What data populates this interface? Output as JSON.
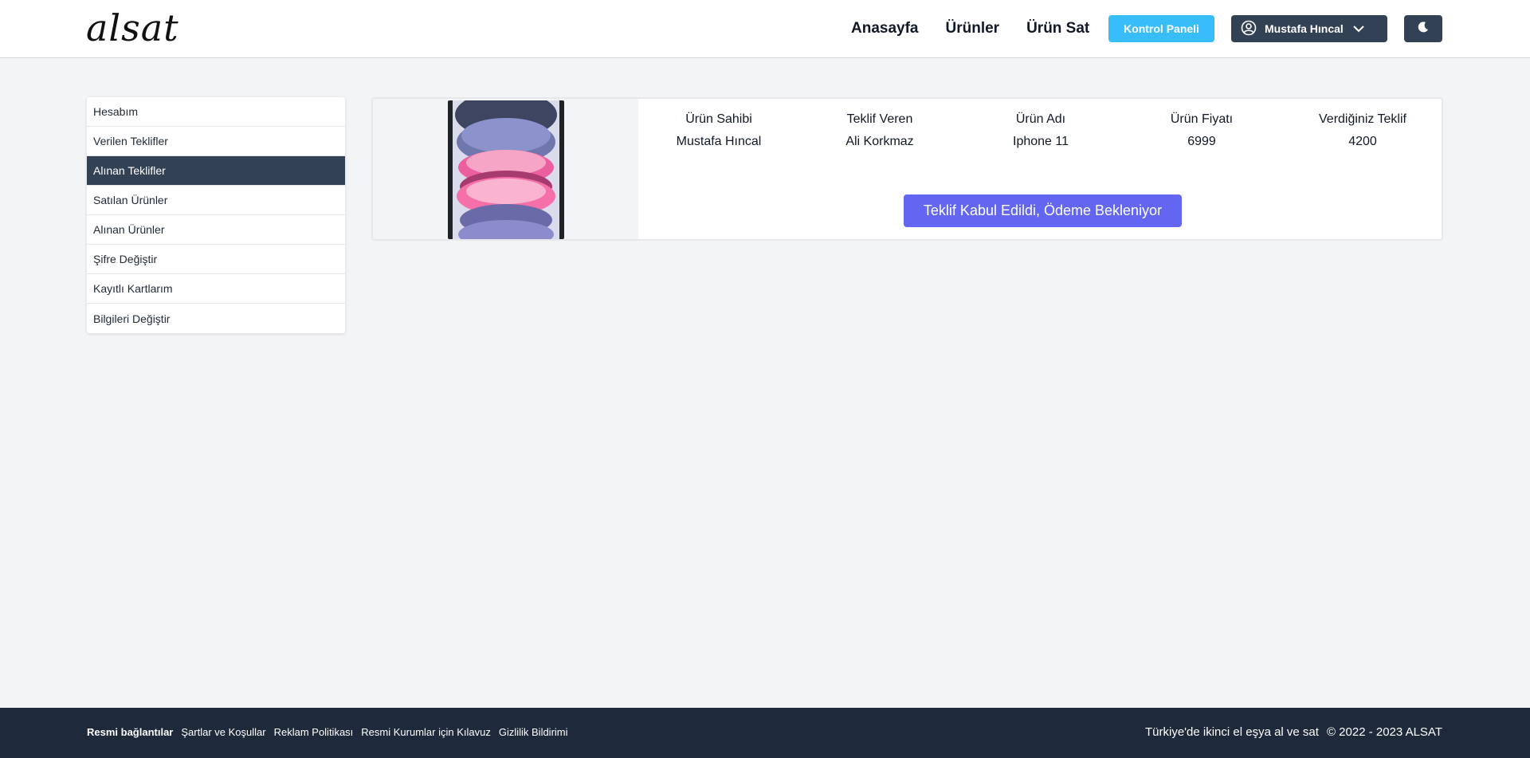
{
  "header": {
    "logo": "alsat",
    "nav": [
      "Anasayfa",
      "Ürünler",
      "Ürün Sat"
    ],
    "panel_button": "Kontrol Paneli",
    "user_name": "Mustafa Hıncal",
    "icons": {
      "user": "user-circle-icon",
      "chevron": "chevron-down-icon",
      "theme": "moon-icon"
    }
  },
  "sidebar": {
    "items": [
      {
        "label": "Hesabım"
      },
      {
        "label": "Verilen Teklifler"
      },
      {
        "label": "Alınan Teklifler",
        "active": true
      },
      {
        "label": "Satılan Ürünler"
      },
      {
        "label": "Alınan Ürünler"
      },
      {
        "label": "Şifre Değiştir"
      },
      {
        "label": "Kayıtlı Kartlarım"
      },
      {
        "label": "Bilgileri Değiştir"
      }
    ]
  },
  "offer": {
    "headers": [
      "Ürün Sahibi",
      "Teklif Veren",
      "Ürün Adı",
      "Ürün Fiyatı",
      "Verdiğiniz Teklif"
    ],
    "values": [
      "Mustafa Hıncal",
      "Ali Korkmaz",
      "Iphone 11",
      "6999",
      "4200"
    ],
    "status": "Teklif Kabul Edildi, Ödeme Bekleniyor"
  },
  "footer": {
    "title": "Resmi bağlantılar",
    "links": [
      "Şartlar ve Koşullar",
      "Reklam Politikası",
      "Resmi Kurumlar için Kılavuz",
      "Gizlilik Bildirimi"
    ],
    "tagline": "Türkiye'de ikinci el eşya al ve sat",
    "copyright": "© 2022 - 2023 ALSAT"
  },
  "colors": {
    "accent": "#38bdf8",
    "dark": "#334155",
    "status": "#6366f1",
    "footer": "#1e293b"
  }
}
